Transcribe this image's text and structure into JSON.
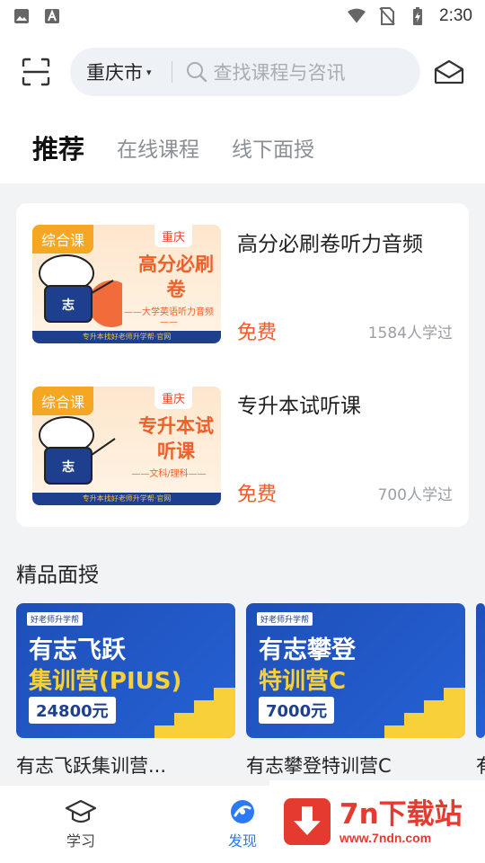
{
  "status_bar": {
    "time": "2:30"
  },
  "header": {
    "city": "重庆市",
    "search_placeholder": "查找课程与咨讯"
  },
  "tabs": [
    {
      "label": "推荐",
      "active": true
    },
    {
      "label": "在线课程",
      "active": false
    },
    {
      "label": "线下面授",
      "active": false
    }
  ],
  "courses": [
    {
      "thumb_tag": "综合课",
      "thumb_city": "重庆",
      "thumb_title": "高分必刷卷",
      "thumb_sub": "——大学英语听力音频——",
      "thumb_footer": "专升本找好老师升学帮·官网",
      "title": "高分必刷卷听力音频",
      "price": "免费",
      "learners": "1584人学过"
    },
    {
      "thumb_tag": "综合课",
      "thumb_city": "重庆",
      "thumb_title": "专升本试听课",
      "thumb_sub": "——文科/理科——",
      "thumb_footer": "专升本找好老师升学帮·官网",
      "title": "专升本试听课",
      "price": "免费",
      "learners": "700人学过"
    }
  ],
  "featured": {
    "title": "精品面授",
    "items": [
      {
        "logo": "好老师升学帮",
        "line1": "有志飞跃",
        "line2": "集训营(PIUS)",
        "price": "24800元",
        "label": "有志飞跃集训营..."
      },
      {
        "logo": "好老师升学帮",
        "line1": "有志攀登",
        "line2": "特训营C",
        "price": "7000元",
        "label": "有志攀登特训营C"
      }
    ],
    "partial_label": "有"
  },
  "bottom_nav": [
    {
      "label": "学习",
      "icon": "graduation-cap-icon",
      "active": false
    },
    {
      "label": "发现",
      "icon": "discover-icon",
      "active": true
    }
  ],
  "watermark": {
    "big": "7n下载站",
    "small": "www.7ndn.com"
  },
  "colors": {
    "accent": "#2b79f6",
    "price": "#f15a2b",
    "promo_blue": "#2561d4",
    "promo_yellow": "#f8d13a"
  }
}
